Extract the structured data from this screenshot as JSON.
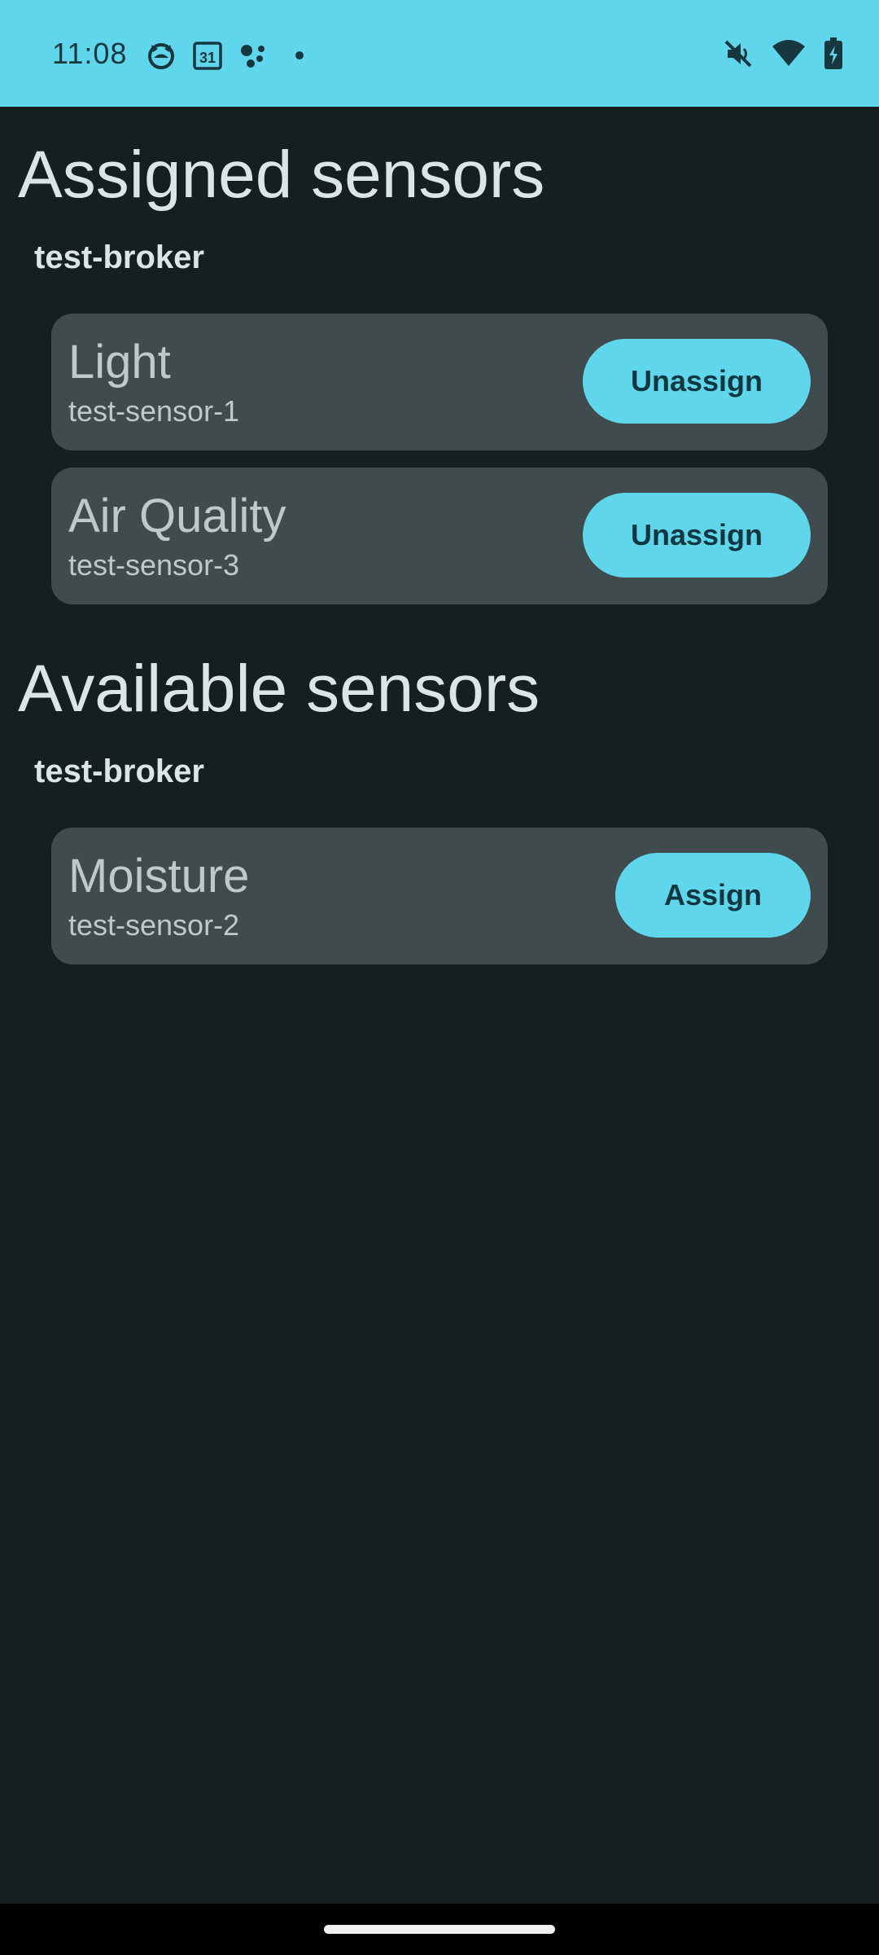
{
  "status_bar": {
    "time": "11:08",
    "calendar_day": "31",
    "background": "#5fd6ec",
    "left_icons": [
      "cat-face-icon",
      "calendar-icon",
      "assistant-dots-icon",
      "notification-dot-icon"
    ],
    "right_icons": [
      "mute-icon",
      "wifi-icon",
      "battery-charging-icon"
    ]
  },
  "assigned": {
    "title": "Assigned sensors",
    "groups": [
      {
        "broker": "test-broker",
        "sensors": [
          {
            "name": "Light",
            "id": "test-sensor-1",
            "action": "Unassign"
          },
          {
            "name": "Air Quality",
            "id": "test-sensor-3",
            "action": "Unassign"
          }
        ]
      }
    ]
  },
  "available": {
    "title": "Available sensors",
    "groups": [
      {
        "broker": "test-broker",
        "sensors": [
          {
            "name": "Moisture",
            "id": "test-sensor-2",
            "action": "Assign"
          }
        ]
      }
    ]
  },
  "colors": {
    "background": "#171e20",
    "card": "#3f4b4d",
    "accent": "#5fd6ec",
    "heading_text": "#dbe5e7",
    "card_text": "#bfc8ca"
  }
}
